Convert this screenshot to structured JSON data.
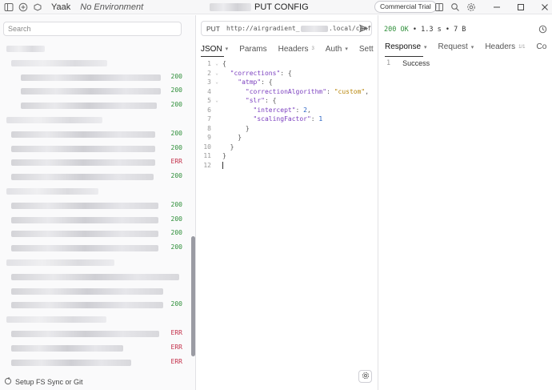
{
  "app": {
    "name": "Yaak",
    "environment": "No Environment",
    "request_title": "PUT CONFIG",
    "license_button": "Commercial Trial"
  },
  "sidebar": {
    "search_placeholder": "Search",
    "rows": [
      {
        "status": ""
      },
      {
        "status": ""
      },
      {
        "status": "200"
      },
      {
        "status": "200"
      },
      {
        "status": "200"
      },
      {
        "status": ""
      },
      {
        "status": "200"
      },
      {
        "status": "200"
      },
      {
        "status": "ERR"
      },
      {
        "status": "200"
      },
      {
        "status": ""
      },
      {
        "status": "200"
      },
      {
        "status": "200"
      },
      {
        "status": "200"
      },
      {
        "status": "200"
      },
      {
        "status": ""
      },
      {
        "status": ""
      },
      {
        "status": ""
      },
      {
        "status": "200"
      },
      {
        "status": ""
      },
      {
        "status": "ERR"
      },
      {
        "status": "ERR"
      },
      {
        "status": "ERR"
      }
    ],
    "footer": "Setup FS Sync or Git"
  },
  "request": {
    "method": "PUT",
    "url_prefix": "http://airgradient_",
    "url_suffix": ".local/conf",
    "tabs": [
      {
        "label": "JSON",
        "count": "",
        "chevron": true
      },
      {
        "label": "Params",
        "count": "",
        "chevron": false
      },
      {
        "label": "Headers",
        "count": "3",
        "chevron": false
      },
      {
        "label": "Auth",
        "count": "",
        "chevron": true
      },
      {
        "label": "Sett",
        "count": "",
        "chevron": false
      }
    ],
    "body_lines": [
      "{",
      "  \"corrections\": {",
      "    \"atmp\": {",
      "      \"correctionAlgorithm\": \"custom\",",
      "      \"slr\": {",
      "        \"intercept\": 2,",
      "        \"scalingFactor\": 1",
      "      }",
      "    }",
      "  }",
      "}"
    ]
  },
  "response": {
    "status_code": "200 OK",
    "time": "1.3 s",
    "size": "7 B",
    "tabs": [
      {
        "label": "Response",
        "count": "",
        "chevron": true
      },
      {
        "label": "Request",
        "count": "",
        "chevron": true
      },
      {
        "label": "Headers",
        "count": "1/1",
        "chevron": false
      },
      {
        "label": "Co",
        "count": "",
        "chevron": false
      }
    ],
    "body_lines": [
      "Success"
    ]
  },
  "colors": {
    "ok": "#2f8f3a",
    "err": "#c4314b",
    "json_key": "#7b3fbf",
    "json_string": "#b8860b",
    "json_number": "#2a63c4"
  }
}
